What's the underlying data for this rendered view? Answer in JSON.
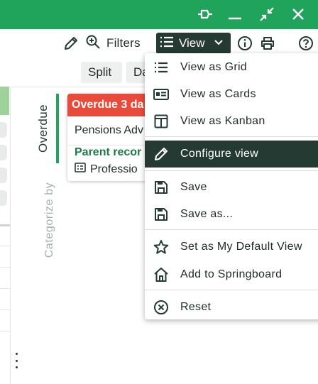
{
  "titlebar": {
    "bg": "#20a35a",
    "icons": [
      "pin-icon",
      "minimize-icon",
      "collapse-icon",
      "close-icon"
    ]
  },
  "toolbar": {
    "filters_label": "Filters",
    "view_label": "View",
    "icons": [
      "edit-pencil-icon",
      "zoom-icon",
      "list-icon",
      "chevron-down-icon",
      "info-icon",
      "print-icon",
      "help-icon"
    ]
  },
  "subbar": {
    "split_label": "Split",
    "partial_label": "Da"
  },
  "board": {
    "categorize_label": "Categorize by",
    "overdue_tab": "Overdue",
    "card": {
      "header": "Overdue 3 da",
      "line1": "Pensions Adv",
      "parent_label": "Parent recor",
      "line3": "Professio"
    }
  },
  "menu": {
    "items": [
      {
        "label": "View as Grid",
        "icon": "grid-list-icon"
      },
      {
        "label": "View as Cards",
        "icon": "cards-icon"
      },
      {
        "label": "View as Kanban",
        "icon": "kanban-icon"
      },
      {
        "label": "Configure view",
        "icon": "pencil-icon",
        "active": true
      },
      {
        "label": "Save",
        "icon": "save-icon"
      },
      {
        "label": "Save as...",
        "icon": "save-as-icon"
      },
      {
        "label": "Set as My Default View",
        "icon": "star-icon"
      },
      {
        "label": "Add to Springboard",
        "icon": "home-icon"
      },
      {
        "label": "Reset",
        "icon": "reset-icon"
      }
    ]
  },
  "colors": {
    "primary_dark": "#243a33",
    "accent_green": "#20a35a",
    "overdue_red": "#e84b3a",
    "parent_green": "#1f7a4a"
  }
}
